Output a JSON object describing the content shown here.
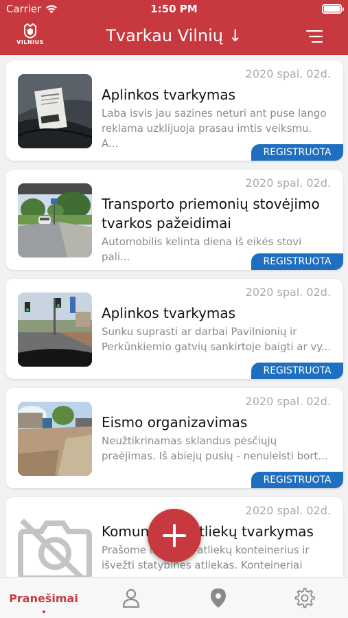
{
  "status_bar": {
    "carrier": "Carrier",
    "time": "1:50 PM"
  },
  "header": {
    "logo_text": "VILNIUS",
    "title": "Tvarkau Vilnių ↓"
  },
  "reports": [
    {
      "date": "2020 spal. 02d.",
      "title": "Aplinkos tvarkymas",
      "description": "Laba isvis jau sazines neturi ant puse lango reklama uzklijuoja prasau imtis veiksmu. A...",
      "status": "REGISTRUOTA"
    },
    {
      "date": "2020 spal. 02d.",
      "title": "Transporto priemonių stovėjimo tvarkos pažeidimai",
      "description": "Automobilis kelinta diena iš eikės stovi pali...",
      "status": "REGISTRUOTA"
    },
    {
      "date": "2020 spal. 02d.",
      "title": "Aplinkos tvarkymas",
      "description": "Sunku suprasti ar darbai Pavilnionių ir Perkūnkiemio gatvių sankirtoje baigti ar vy...",
      "status": "REGISTRUOTA"
    },
    {
      "date": "2020 spal. 02d.",
      "title": "Eismo organizavimas",
      "description": "Neužtikrinamas sklandus pėsčiųjų praėjimas. Iš abiejų pusių - nenuleisti bort...",
      "status": "REGISTRUOTA"
    },
    {
      "date": "2020 spal. 02d.",
      "title": "Komunalinių atliekų tvarkymas",
      "description": "Prašome ištuštinti atliekų konteinerius ir išvežti statybines atliekas. Konteineriai yra...",
      "status": ""
    }
  ],
  "tabs": [
    {
      "label": "Pranešimai",
      "icon": "reports",
      "active": true
    },
    {
      "label": "",
      "icon": "person-icon",
      "active": false
    },
    {
      "label": "",
      "icon": "map-pin-icon",
      "active": false
    },
    {
      "label": "",
      "icon": "gear-icon",
      "active": false
    }
  ],
  "colors": {
    "brand": "#c8383f",
    "status": "#1e6fc0"
  }
}
